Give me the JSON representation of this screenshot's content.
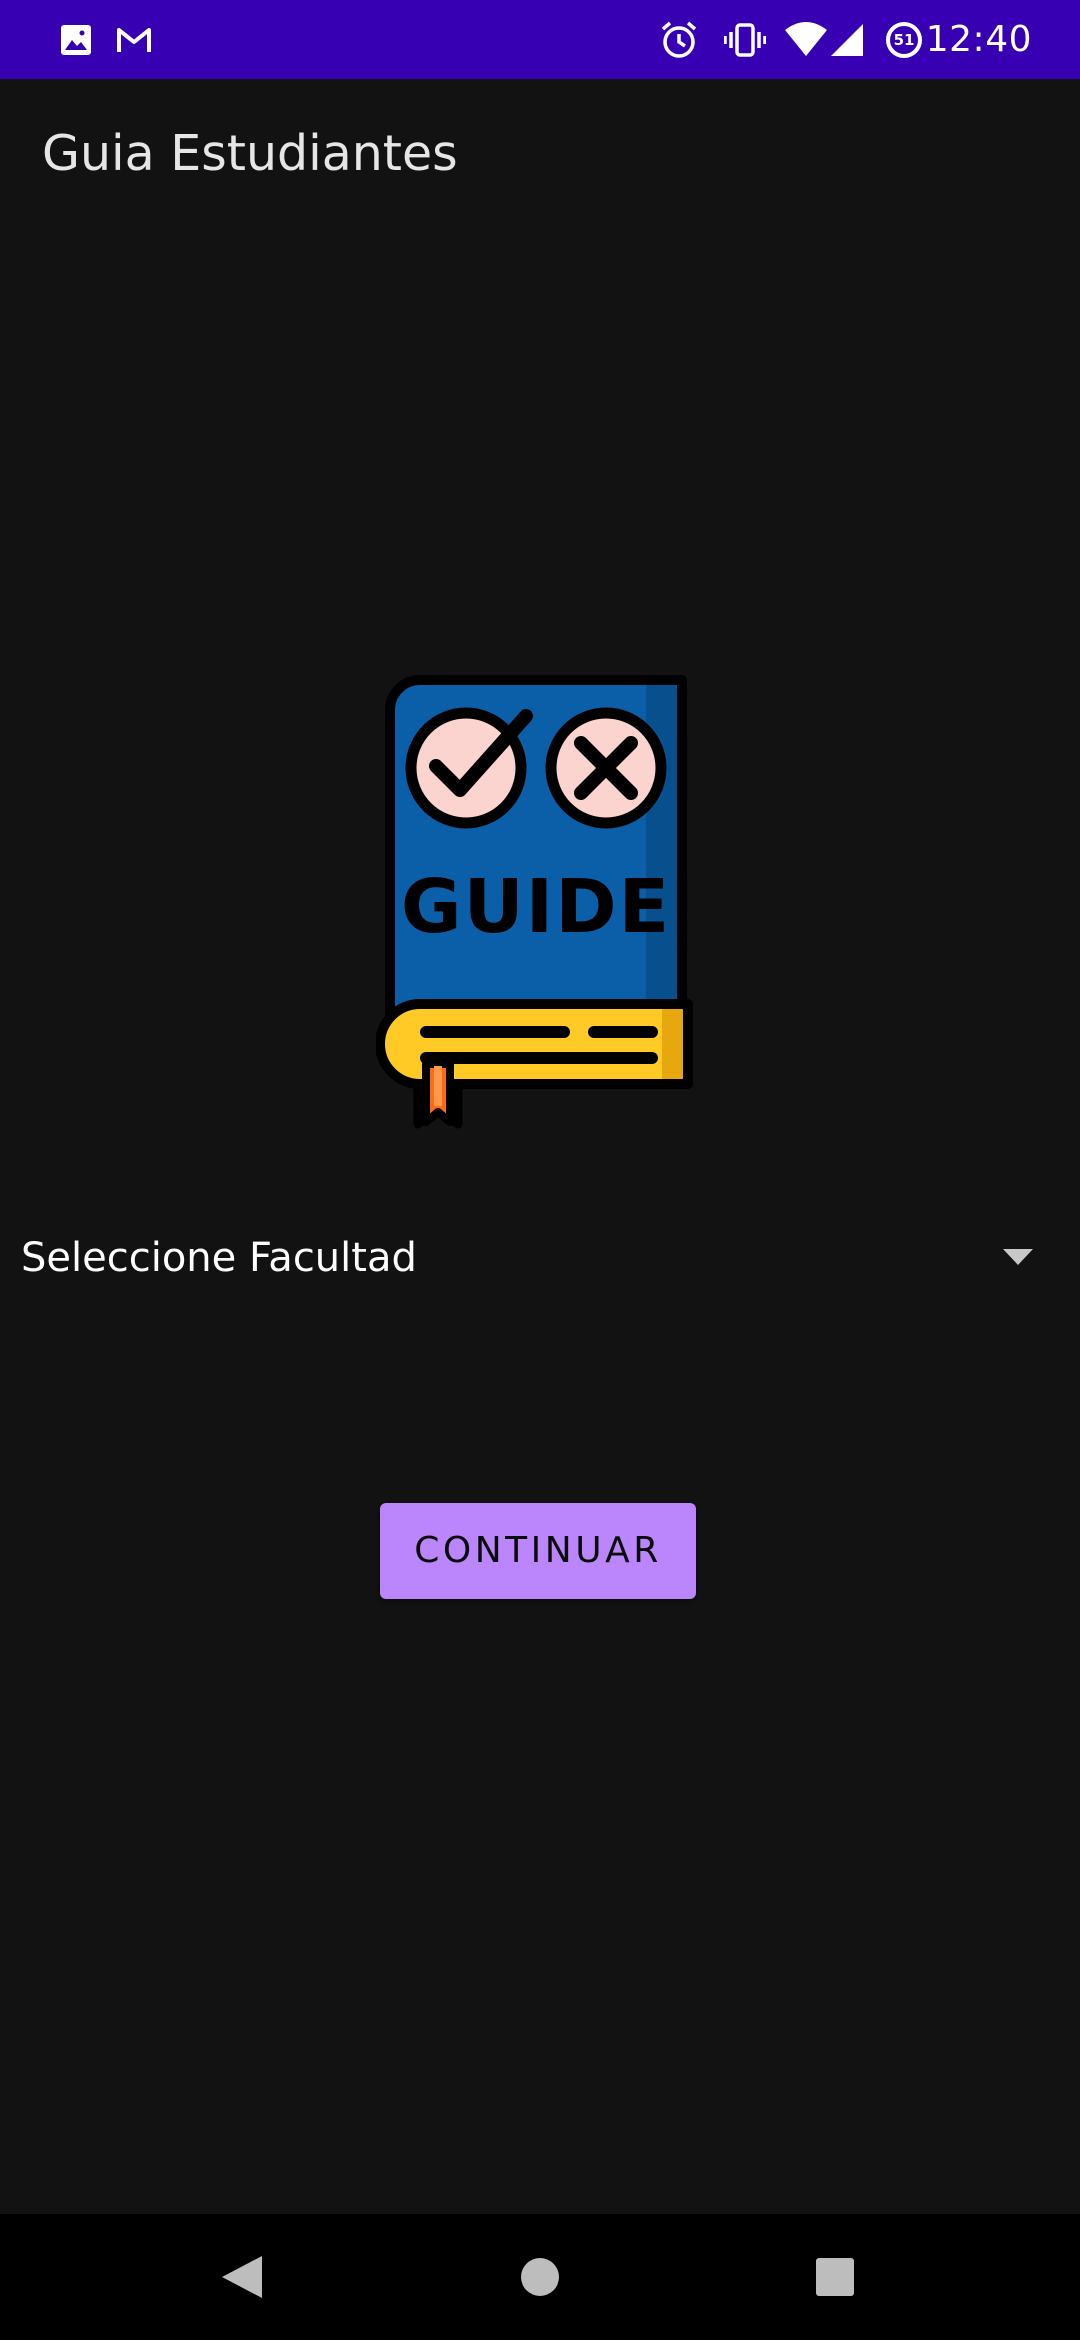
{
  "status_bar": {
    "time": "12:40",
    "icons": [
      "image-icon",
      "gmail-icon",
      "alarm-icon",
      "vibrate-icon",
      "wifi-icon",
      "signal-icon",
      "data-saver-icon"
    ],
    "data_badge": "51",
    "color": "#3700B3"
  },
  "app": {
    "title": "Guia Estudiantes"
  },
  "logo": {
    "icon": "guide-book-icon",
    "text": "GUIDE",
    "colors": {
      "cover": "#0B5FA8",
      "pages": "#FFC926",
      "bookmark": "#FF6A1A",
      "circles": "#FBD3CF"
    }
  },
  "spinner": {
    "selected": "Seleccione Facultad"
  },
  "actions": {
    "continue_label": "CONTINUAR",
    "accent": "#BB86FC"
  },
  "nav_bar": {
    "icons": [
      "back-icon",
      "home-icon",
      "recents-icon"
    ]
  }
}
